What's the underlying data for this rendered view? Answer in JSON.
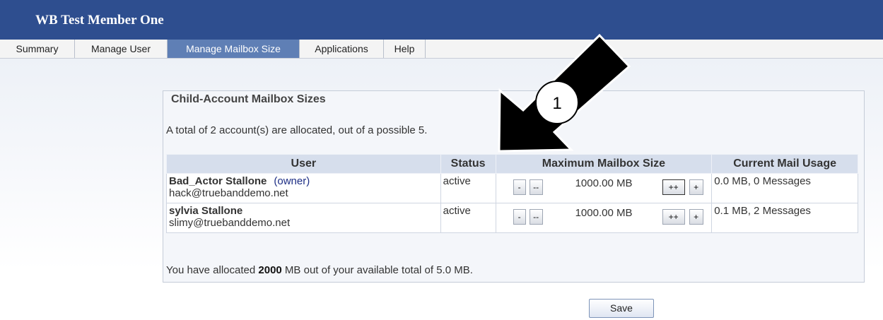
{
  "header": {
    "title": "WB Test Member One"
  },
  "tabs": [
    {
      "label": "Summary",
      "active": false
    },
    {
      "label": "Manage User",
      "active": false
    },
    {
      "label": "Manage Mailbox Size",
      "active": true
    },
    {
      "label": "Applications",
      "active": false
    },
    {
      "label": "Help",
      "active": false
    }
  ],
  "section": {
    "legend": "Child-Account Mailbox Sizes",
    "summary": "A total of 2 account(s) are allocated, out of a possible 5."
  },
  "table": {
    "headers": [
      "User",
      "Status",
      "Maximum Mailbox Size",
      "Current Mail Usage"
    ],
    "rows": [
      {
        "name": "Bad_Actor Stallone",
        "owner_tag": "(owner)",
        "email": "hack@truebanddemo.net",
        "status": "active",
        "size": "1000.00 MB",
        "usage": "0.0 MB, 0 Messages"
      },
      {
        "name": "sylvia Stallone",
        "owner_tag": "",
        "email": "slimy@truebanddemo.net",
        "status": "active",
        "size": "1000.00 MB",
        "usage": "0.1 MB, 2 Messages"
      }
    ],
    "buttons": {
      "minus": "-",
      "minus_big": "--",
      "plus_big": "++",
      "plus": "+"
    }
  },
  "allocation": {
    "prefix": "You have allocated ",
    "amount": "2000",
    "suffix": " MB out of your available total of 5.0 MB."
  },
  "save_label": "Save",
  "annotation": {
    "label": "1"
  },
  "colors": {
    "header_bg": "#2e4e8f",
    "active_tab": "#5f7fb5",
    "table_header": "#d6deec"
  }
}
